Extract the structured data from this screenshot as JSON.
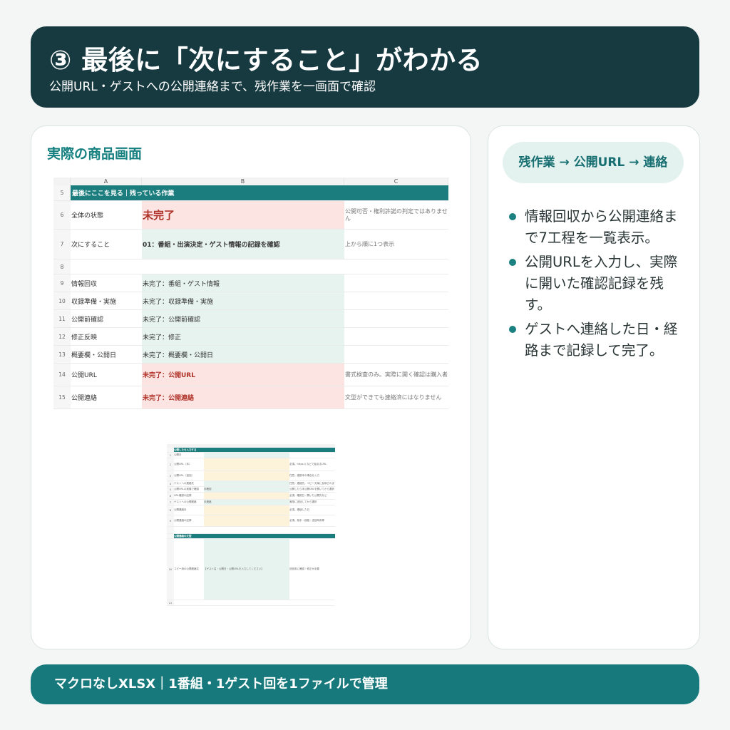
{
  "header": {
    "title": "③ 最後に「次にすること」がわかる",
    "subtitle": "公開URL・ゲストへの公開連絡まで、残作業を一画面で確認"
  },
  "left_card": {
    "title": "実際の商品画面",
    "sheet": {
      "columns": [
        "A",
        "B",
        "C"
      ],
      "section_row": {
        "num": "5",
        "label": "最後にここを見る｜残っている作業"
      },
      "rows": [
        {
          "num": "6",
          "a": "全体の状態",
          "b": "未完了",
          "c": "公開可否・権利許諾の判定ではありません",
          "style": "big"
        },
        {
          "num": "7",
          "a": "次にすること",
          "b": "01：番組・出演決定・ゲスト情報の記録を確認",
          "c": "上から順に1つ表示",
          "style": "next"
        },
        {
          "num": "8",
          "a": "",
          "b": "",
          "c": "",
          "style": "blank"
        },
        {
          "num": "9",
          "a": "情報回収",
          "b": "未完了：番組・ゲスト情報",
          "c": "",
          "style": "mint"
        },
        {
          "num": "10",
          "a": "収録準備・実施",
          "b": "未完了：収録準備・実施",
          "c": "",
          "style": "mint"
        },
        {
          "num": "11",
          "a": "公開前確認",
          "b": "未完了：公開前確認",
          "c": "",
          "style": "mint"
        },
        {
          "num": "12",
          "a": "修正反映",
          "b": "未完了：修正",
          "c": "",
          "style": "mint"
        },
        {
          "num": "13",
          "a": "概要欄・公開日",
          "b": "未完了：概要欄・公開日",
          "c": "",
          "style": "mint"
        },
        {
          "num": "14",
          "a": "公開URL",
          "b": "未完了：公開URL",
          "c": "書式検査のみ。実際に開く確認は購入者",
          "style": "pinkred"
        },
        {
          "num": "15",
          "a": "公開連絡",
          "b": "未完了：公開連絡",
          "c": "文型ができても連絡済にはなりません",
          "style": "pinkred"
        }
      ]
    },
    "mini_sheet": {
      "title1": "公開したら入力する",
      "title2": "公開連絡の文型",
      "rows": [
        {
          "num": "1",
          "a": "公開日",
          "b": "",
          "c": "",
          "fill": "mint"
        },
        {
          "num": "2",
          "a": "公開URL（本）",
          "b": "",
          "c": "必須。https:// などで始まるURL",
          "fill": "yellow"
        },
        {
          "num": "3",
          "a": "公開URL（追加）",
          "b": "",
          "c": "任意。複数本の場合を入力",
          "fill": "yellow"
        },
        {
          "num": "4",
          "a": "ゲストへの連絡先",
          "b": "",
          "c": "任意。連絡先。コピー文案に反映されます",
          "fill": "mint"
        },
        {
          "num": "5",
          "a": "公開URLの実機で確認",
          "b": "未確認",
          "c": "公開したら本公開URLを開いてから選択",
          "fill": "mint"
        },
        {
          "num": "6",
          "a": "URL確認の記録",
          "b": "",
          "c": "必須。確認日・開いた公開先など",
          "fill": "yellow"
        },
        {
          "num": "7",
          "a": "ゲストへの公開連絡",
          "b": "未連絡",
          "c": "実際に送信してから選択",
          "fill": "mint"
        },
        {
          "num": "8",
          "a": "公開連絡日",
          "b": "",
          "c": "必須。連絡した日",
          "fill": "yellow"
        },
        {
          "num": "9",
          "a": "公開連絡の記録",
          "b": "",
          "c": "必須。相手・経路・送信時刻等",
          "fill": "yellow"
        }
      ],
      "copy_row": {
        "num": "20",
        "a": "コピー用の公開連絡文",
        "b": "【ゲスト名・公開日・公開URLを入力してください】",
        "c": "送信前に確認・修正が必要"
      },
      "end_num": "21"
    }
  },
  "right_card": {
    "pill": "残作業 → 公開URL → 連絡",
    "bullets": [
      "情報回収から公開連絡まで7工程を一覧表示。",
      "公開URLを入力し、実際に開いた確認記録を残す。",
      "ゲストへ連絡した日・経路まで記録して完了。"
    ]
  },
  "footer": {
    "text": "マクロなしXLSX｜1番組・1ゲスト回を1ファイルで管理"
  },
  "colors": {
    "dark_teal": "#173a41",
    "teal": "#17797b",
    "accent": "#168080",
    "pink": "#fce4e2",
    "mint": "#e7f3ef",
    "red": "#b0332a"
  }
}
